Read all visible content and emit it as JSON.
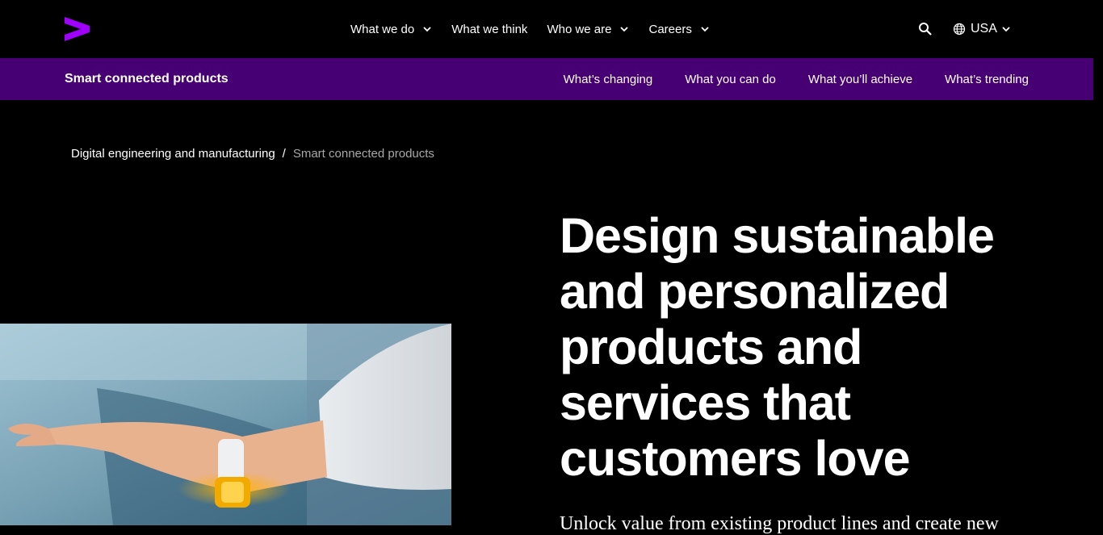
{
  "header": {
    "logo": "accenture-greater-than-logo",
    "nav": [
      {
        "label": "What we do",
        "has_dropdown": true
      },
      {
        "label": "What we think",
        "has_dropdown": false
      },
      {
        "label": "Who we are",
        "has_dropdown": true
      },
      {
        "label": "Careers",
        "has_dropdown": true
      }
    ],
    "locale": "USA",
    "brand_color": "#a100ff"
  },
  "subnav": {
    "title": "Smart connected products",
    "links": [
      "What’s changing",
      "What you can do",
      "What you’ll achieve",
      "What’s trending"
    ],
    "background": "#460073"
  },
  "breadcrumb": {
    "parent": "Digital engineering and manufacturing",
    "separator": "/",
    "current": "Smart connected products"
  },
  "hero": {
    "headline": "Design sustainable and personalized products and services that customers love",
    "lede": "Unlock value from existing product lines and create new"
  }
}
